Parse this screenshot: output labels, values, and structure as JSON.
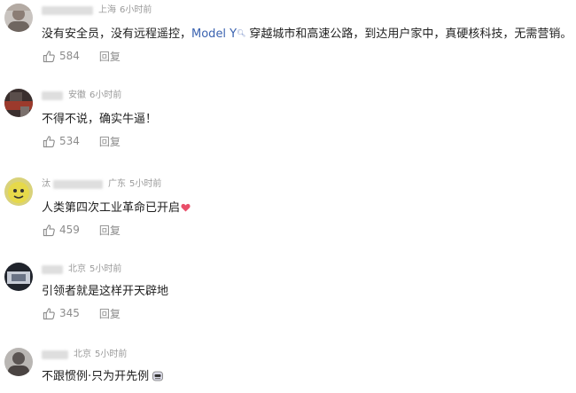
{
  "comments": [
    {
      "name_char": "",
      "location": "上海",
      "time": "6小时前",
      "text_pre": "没有安全员，没有远程遥控，",
      "text_link": "Model Y",
      "text_post": " 穿越城市和高速公路，到达用户家中，真硬核科技，无需营销。",
      "likes": "584",
      "reply": "回复"
    },
    {
      "name_char": "",
      "location": "安徽",
      "time": "6小时前",
      "text": "不得不说，确实牛逼！",
      "likes": "534",
      "reply": "回复"
    },
    {
      "name_char": "汰",
      "location": "广东",
      "time": "5小时前",
      "text": "人类第四次工业革命已开启",
      "likes": "459",
      "reply": "回复"
    },
    {
      "name_char": "",
      "location": "北京",
      "time": "5小时前",
      "text": "引领者就是这样开天辟地",
      "likes": "345",
      "reply": "回复"
    },
    {
      "name_char": "",
      "location": "北京",
      "time": "5小时前",
      "text": "不跟惯例·只为开先例",
      "likes": "",
      "reply": ""
    }
  ],
  "colors": {
    "link": "#3b63b0",
    "meta": "#9a9a9a",
    "text": "#1f1f1f",
    "heart": "#e94f6a"
  },
  "icons": {
    "like": "thumbs-up-icon",
    "heart": "heart-emoji-icon",
    "search": "search-icon"
  }
}
